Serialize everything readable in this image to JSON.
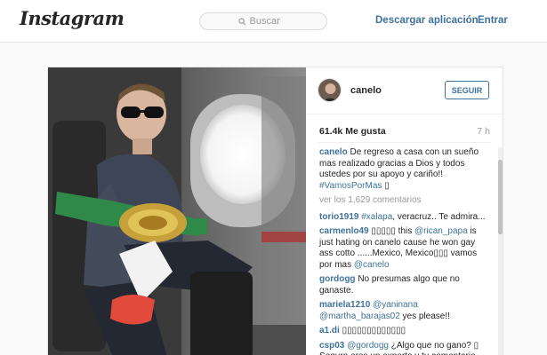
{
  "header": {
    "logo": "Instagram",
    "search_placeholder": "Buscar",
    "download_app": "Descargar aplicación",
    "login": "Entrar"
  },
  "post": {
    "username": "canelo",
    "follow_label": "SEGUIR",
    "likes": "61.4k Me gusta",
    "time": "7 h",
    "caption": {
      "user": "canelo",
      "text": "De regreso a casa con un sueño mas realizado gracias a Dios y todos ustedes por su apoyo y cariño!!",
      "hashtag": "#VamosPorMas",
      "trailing_glyph": "▯"
    },
    "view_more": "ver los 1,629 comentarios",
    "comments": [
      {
        "user": "torio1919",
        "tag": "#xalapa",
        "text": ", veracruz.. Te admira..."
      },
      {
        "user": "carmenlo49",
        "pre": "▯▯▯▯▯ this ",
        "tag": "@rican_papa",
        "text": " is just hating on canelo cause he won gay ass cotto ......Mexico, Mexico▯▯▯ vamos por mas ",
        "tag2": "@canelo"
      },
      {
        "user": "gordogg",
        "text": "No presumas algo que no ganaste."
      },
      {
        "user": "mariela1210",
        "tag": "@yaninana",
        "tag2": "@martha_barajas02",
        "text": " yes please!!"
      },
      {
        "user": "a1.di",
        "text": "▯▯▯▯▯▯▯▯▯▯▯▯▯"
      },
      {
        "user": "csp03",
        "tag": "@gordogg",
        "text": " ¿Algo que no gano? ▯ Seguro eres un experto y tu comentario"
      }
    ]
  },
  "colors": {
    "link": "#3f729b",
    "border": "#e6e6e6",
    "background": "#fafafa"
  },
  "icons": [
    "search-icon"
  ]
}
